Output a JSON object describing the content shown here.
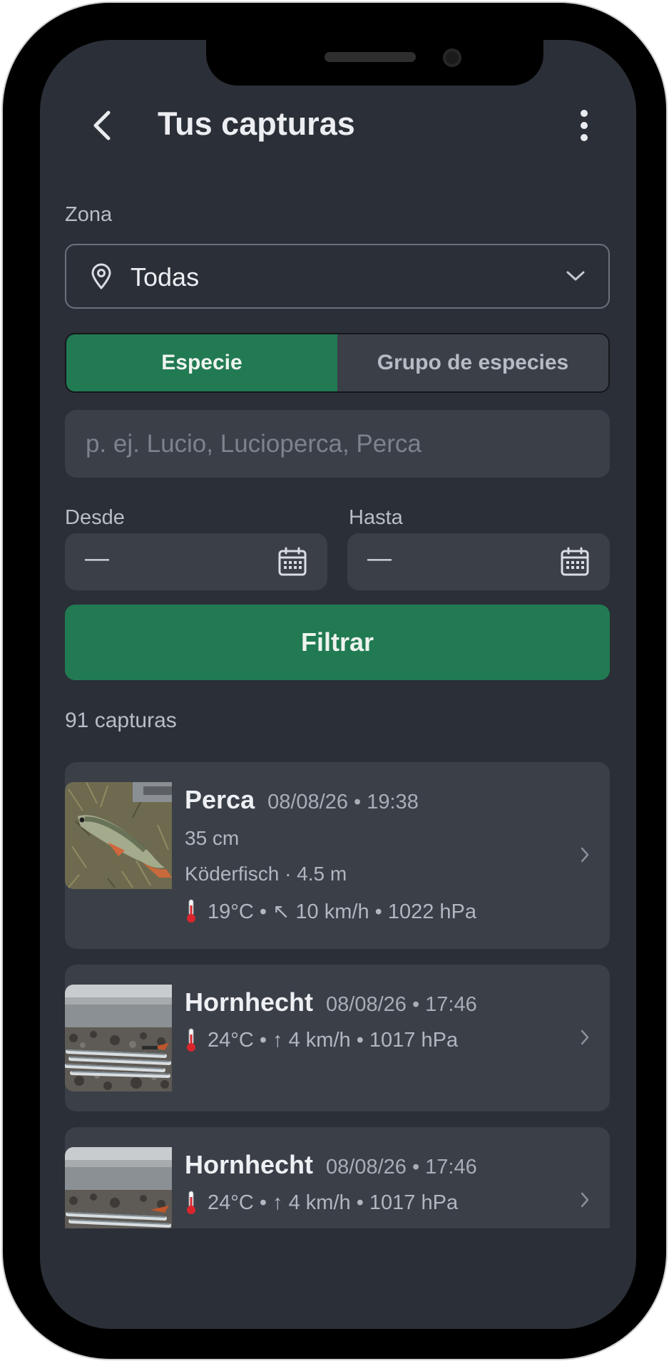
{
  "header": {
    "title": "Tus capturas"
  },
  "zone": {
    "label": "Zona",
    "value": "Todas"
  },
  "segmented": {
    "options": [
      "Especie",
      "Grupo de especies"
    ],
    "selected": "Especie"
  },
  "search": {
    "placeholder": "p. ej. Lucio, Lucioperca, Perca",
    "value": ""
  },
  "dates": {
    "from_label": "Desde",
    "from_value": "—",
    "to_label": "Hasta",
    "to_value": "—"
  },
  "filter_button": "Filtrar",
  "count": "91 capturas",
  "catches": [
    {
      "species": "Perca",
      "datetime": "08/08/26 • 19:38",
      "length": "35 cm",
      "bait_depth": "Köderfisch · 4.5 m",
      "weather": "19°C • ↖ 10 km/h • 1022 hPa"
    },
    {
      "species": "Hornhecht",
      "datetime": "08/08/26 • 17:46",
      "weather": "24°C • ↑ 4 km/h • 1017 hPa"
    },
    {
      "species": "Hornhecht",
      "datetime": "08/08/26 • 17:46",
      "weather": "24°C • ↑ 4 km/h • 1017 hPa"
    }
  ],
  "colors": {
    "background": "#2b2f37",
    "surface": "#3a3f48",
    "accent_green": "#217a52",
    "text_primary": "#eceef2",
    "text_secondary": "#b9bdc6"
  },
  "icons": {
    "back": "chevron-left-icon",
    "more": "more-vertical-icon",
    "zone": "location-pin-icon",
    "dropdown": "chevron-down-icon",
    "date": "calendar-icon",
    "weather": "thermometer-icon",
    "row": "chevron-right-icon"
  }
}
